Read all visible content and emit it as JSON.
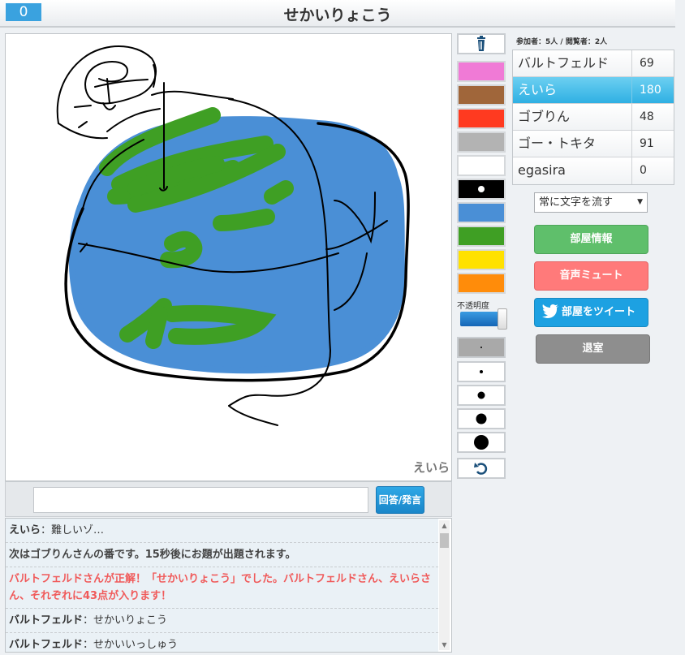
{
  "header": {
    "timer": "0",
    "title": "せかいりょこう"
  },
  "canvas": {
    "drawer_name": "えいら"
  },
  "answer": {
    "placeholder": "",
    "button_label": "回答/発言"
  },
  "chat": {
    "messages": [
      {
        "who": "えいら",
        "sep": "：",
        "text": "難しいゾ…"
      },
      {
        "text": "次はゴブりんさんの番です。15秒後にお題が出題されます。"
      },
      {
        "text": "バルトフェルドさんが正解！「せかいりょこう」でした。バルトフェルドさん、えいらさん、それぞれに43点が入ります！"
      },
      {
        "who": "バルトフェルド",
        "sep": "：",
        "text": "せかいりょこう"
      },
      {
        "who": "バルトフェルド",
        "sep": "：",
        "text": "せかいいっしゅう"
      }
    ]
  },
  "tools": {
    "opacity_label": "不透明度",
    "opacity_value": 1.0,
    "colors": [
      "#f07ad6",
      "#a0663a",
      "#ff3a20",
      "#b3b3b3",
      "#ffffff",
      "#000000",
      "#4a8fd6",
      "#3f9f24",
      "#ffe100",
      "#ff8c0a"
    ],
    "selected_color": "#000000",
    "selected_pen_size_index": 0
  },
  "room": {
    "counts": "参加者：5人 / 閲覧者：2人",
    "players": [
      {
        "name": "バルトフェルド",
        "score": "69"
      },
      {
        "name": "えいら",
        "score": "180"
      },
      {
        "name": "ゴブりん",
        "score": "48"
      },
      {
        "name": "ゴー・トキタ",
        "score": "91"
      },
      {
        "name": "egasira",
        "score": "0"
      }
    ],
    "active_player_index": 1,
    "text_flow_option": "常に文字を流す",
    "buttons": {
      "info": "部屋情報",
      "mute": "音声ミュート",
      "tweet": "部屋をツイート",
      "exit": "退室"
    }
  },
  "colors": {
    "accent": "#2fb0e3",
    "correct_text": "#f05a5a"
  }
}
